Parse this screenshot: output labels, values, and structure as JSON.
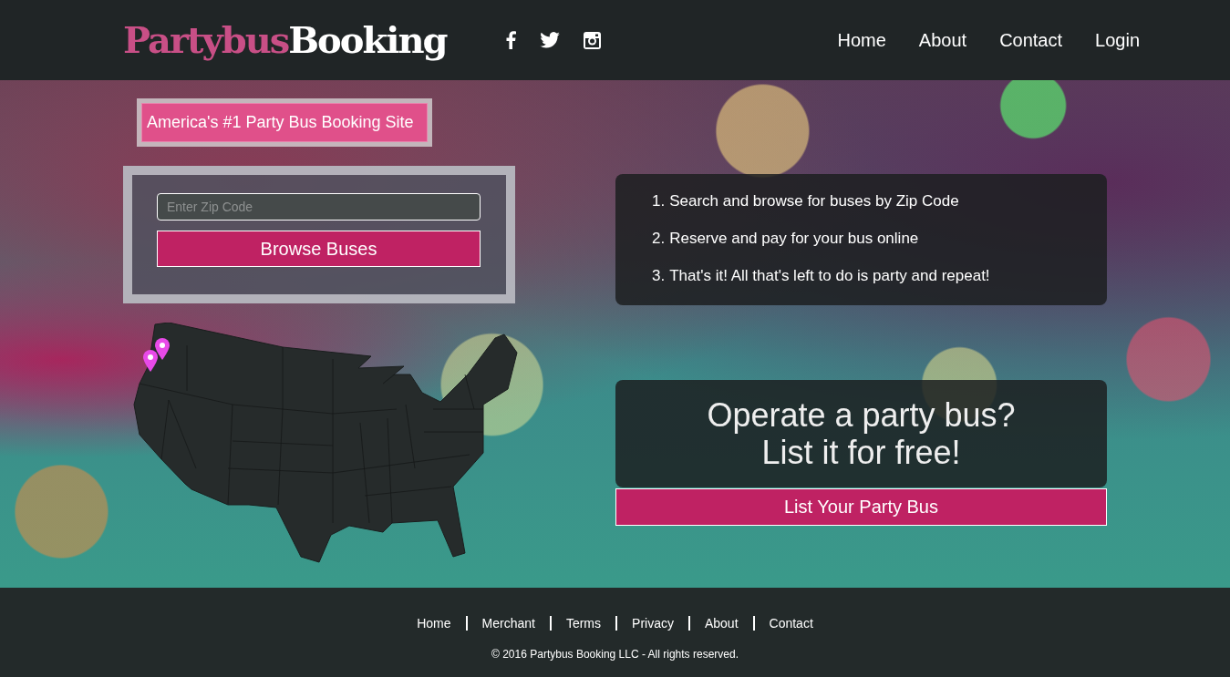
{
  "header": {
    "logo": {
      "first": "Partybus",
      "second": "Booking"
    },
    "nav": [
      "Home",
      "About",
      "Contact",
      "Login"
    ]
  },
  "hero": {
    "tagline": "America's #1 Party Bus Booking Site",
    "search": {
      "placeholder": "Enter Zip Code",
      "button": "Browse Buses"
    },
    "steps": [
      {
        "number": "1.",
        "text": "Search and browse for buses by Zip Code"
      },
      {
        "number": "2.",
        "text": "Reserve and pay for your bus online"
      },
      {
        "number": "3.",
        "text": "That's it! All that's left to do is party and repeat!"
      }
    ],
    "promo": {
      "lines": [
        "Operate a party bus?",
        "List it for free!"
      ],
      "button": "List Your Party Bus"
    }
  },
  "footer": {
    "links": [
      "Home",
      "Merchant",
      "Terms",
      "Privacy",
      "About",
      "Contact"
    ],
    "copyright": "© 2016 Partybus Booking LLC - All rights reserved."
  }
}
